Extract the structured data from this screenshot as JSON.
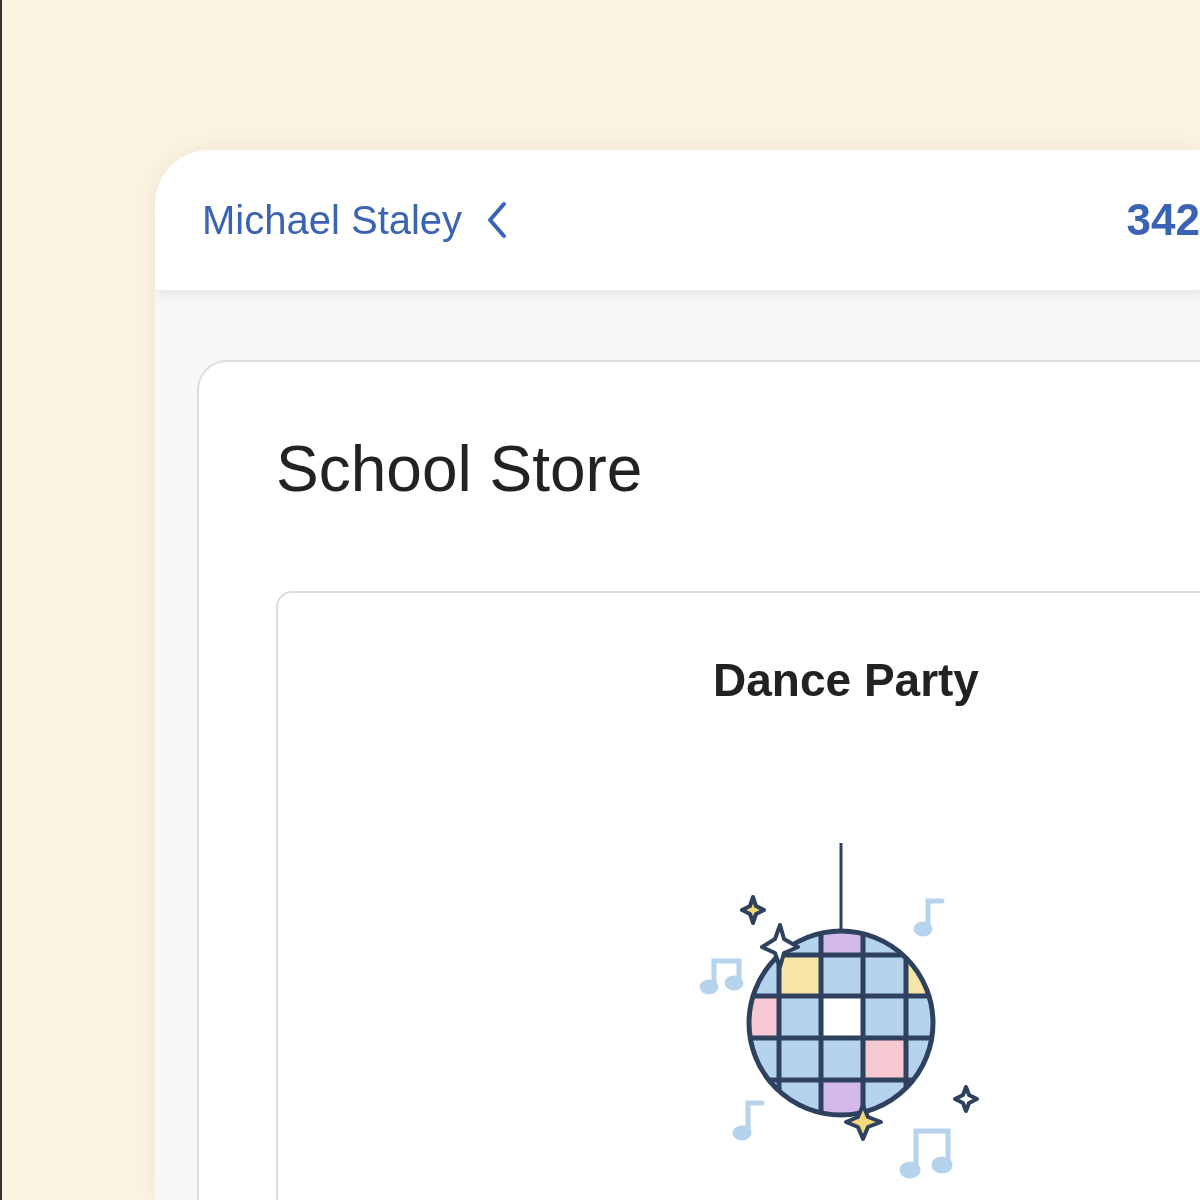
{
  "header": {
    "user_name": "Michael Staley",
    "points": "342"
  },
  "store": {
    "title": "School Store",
    "items": [
      {
        "name": "Dance Party",
        "kind": "disco"
      }
    ]
  }
}
